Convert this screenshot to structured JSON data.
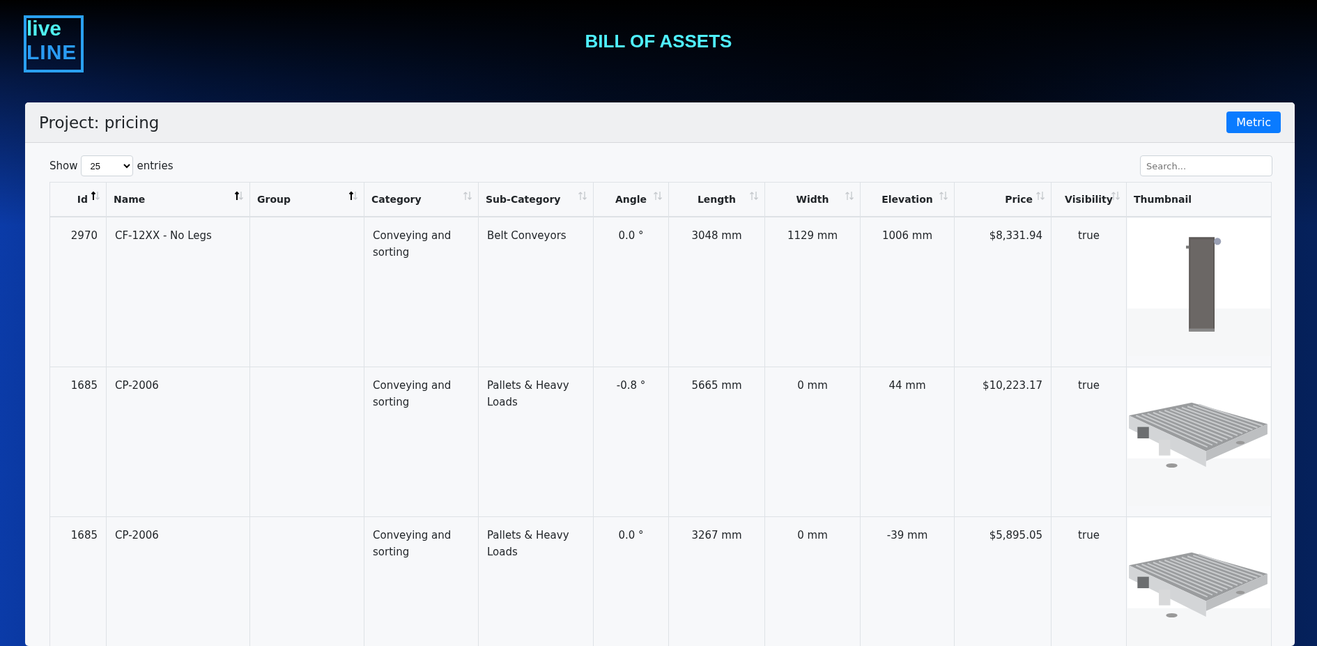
{
  "logo": {
    "top": "live",
    "bottom": "LINE"
  },
  "page_title": "BILL OF ASSETS",
  "card": {
    "title": "Project: pricing",
    "unit_button": "Metric"
  },
  "length_menu": {
    "before": "Show",
    "value": "25",
    "after": "entries"
  },
  "search": {
    "placeholder": "Search..."
  },
  "table": {
    "columns": [
      {
        "label": "Id",
        "sortable": true,
        "sorted": true
      },
      {
        "label": "Name",
        "sortable": true,
        "sorted": true
      },
      {
        "label": "Group",
        "sortable": true,
        "sorted": true
      },
      {
        "label": "Category",
        "sortable": true,
        "sorted": false
      },
      {
        "label": "Sub-Category",
        "sortable": true,
        "sorted": false
      },
      {
        "label": "Angle",
        "sortable": true,
        "sorted": false
      },
      {
        "label": "Length",
        "sortable": true,
        "sorted": false
      },
      {
        "label": "Width",
        "sortable": true,
        "sorted": false
      },
      {
        "label": "Elevation",
        "sortable": true,
        "sorted": false
      },
      {
        "label": "Price",
        "sortable": true,
        "sorted": false
      },
      {
        "label": "Visibility",
        "sortable": true,
        "sorted": false
      },
      {
        "label": "Thumbnail",
        "sortable": false
      }
    ],
    "rows": [
      {
        "cells": [
          "2970",
          "CF-12XX - No Legs",
          "",
          "Conveying and sorting",
          "Belt Conveyors",
          "0.0 °",
          "3048 mm",
          "1129 mm",
          "1006 mm",
          "$8,331.94",
          "true"
        ]
      },
      {
        "cells": [
          "1685",
          "CP-2006",
          "",
          "Conveying and sorting",
          "Pallets & Heavy Loads",
          "-0.8 °",
          "5665 mm",
          "0 mm",
          "44 mm",
          "$10,223.17",
          "true"
        ]
      },
      {
        "cells": [
          "1685",
          "CP-2006",
          "",
          "Conveying and sorting",
          "Pallets & Heavy Loads",
          "0.0 °",
          "3267 mm",
          "0 mm",
          "-39 mm",
          "$5,895.05",
          "true"
        ]
      }
    ]
  }
}
